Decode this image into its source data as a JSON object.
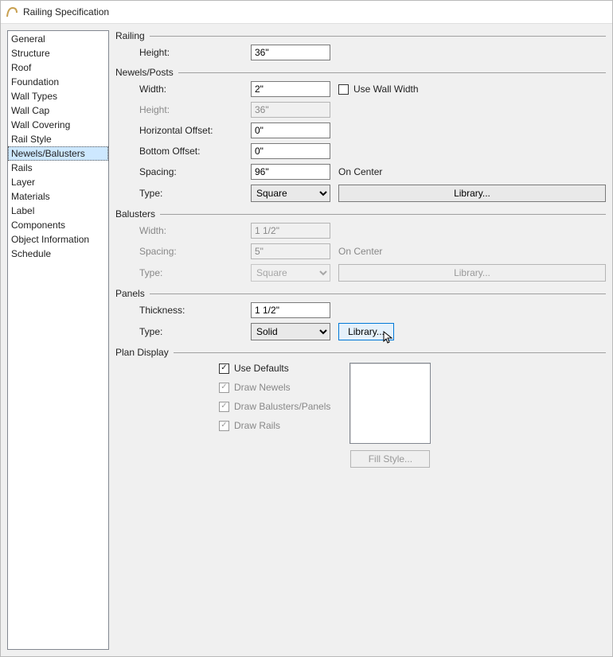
{
  "dialog": {
    "title": "Railing Specification"
  },
  "sidebar": {
    "items": [
      {
        "label": "General"
      },
      {
        "label": "Structure"
      },
      {
        "label": "Roof"
      },
      {
        "label": "Foundation"
      },
      {
        "label": "Wall Types"
      },
      {
        "label": "Wall Cap"
      },
      {
        "label": "Wall Covering"
      },
      {
        "label": "Rail Style"
      },
      {
        "label": "Newels/Balusters",
        "selected": true
      },
      {
        "label": "Rails"
      },
      {
        "label": "Layer"
      },
      {
        "label": "Materials"
      },
      {
        "label": "Label"
      },
      {
        "label": "Components"
      },
      {
        "label": "Object Information"
      },
      {
        "label": "Schedule"
      }
    ]
  },
  "railing": {
    "title": "Railing",
    "height_label": "Height:",
    "height_value": "36\""
  },
  "newels": {
    "title": "Newels/Posts",
    "width_label": "Width:",
    "width_value": "2\"",
    "use_wall_width_label": "Use Wall Width",
    "use_wall_width_checked": false,
    "height_label": "Height:",
    "height_value": "36\"",
    "hoff_label": "Horizontal Offset:",
    "hoff_value": "0\"",
    "boff_label": "Bottom Offset:",
    "boff_value": "0\"",
    "spacing_label": "Spacing:",
    "spacing_value": "96\"",
    "spacing_after": "On Center",
    "type_label": "Type:",
    "type_value": "Square",
    "library_label": "Library..."
  },
  "balusters": {
    "title": "Balusters",
    "width_label": "Width:",
    "width_value": "1 1/2\"",
    "spacing_label": "Spacing:",
    "spacing_value": "5\"",
    "spacing_after": "On Center",
    "type_label": "Type:",
    "type_value": "Square",
    "library_label": "Library..."
  },
  "panels": {
    "title": "Panels",
    "thickness_label": "Thickness:",
    "thickness_value": "1 1/2\"",
    "type_label": "Type:",
    "type_value": "Solid",
    "library_label": "Library..."
  },
  "plan": {
    "title": "Plan Display",
    "use_defaults_label": "Use Defaults",
    "use_defaults_checked": true,
    "draw_newels_label": "Draw Newels",
    "draw_balusters_label": "Draw Balusters/Panels",
    "draw_rails_label": "Draw Rails",
    "fill_style_label": "Fill Style..."
  }
}
